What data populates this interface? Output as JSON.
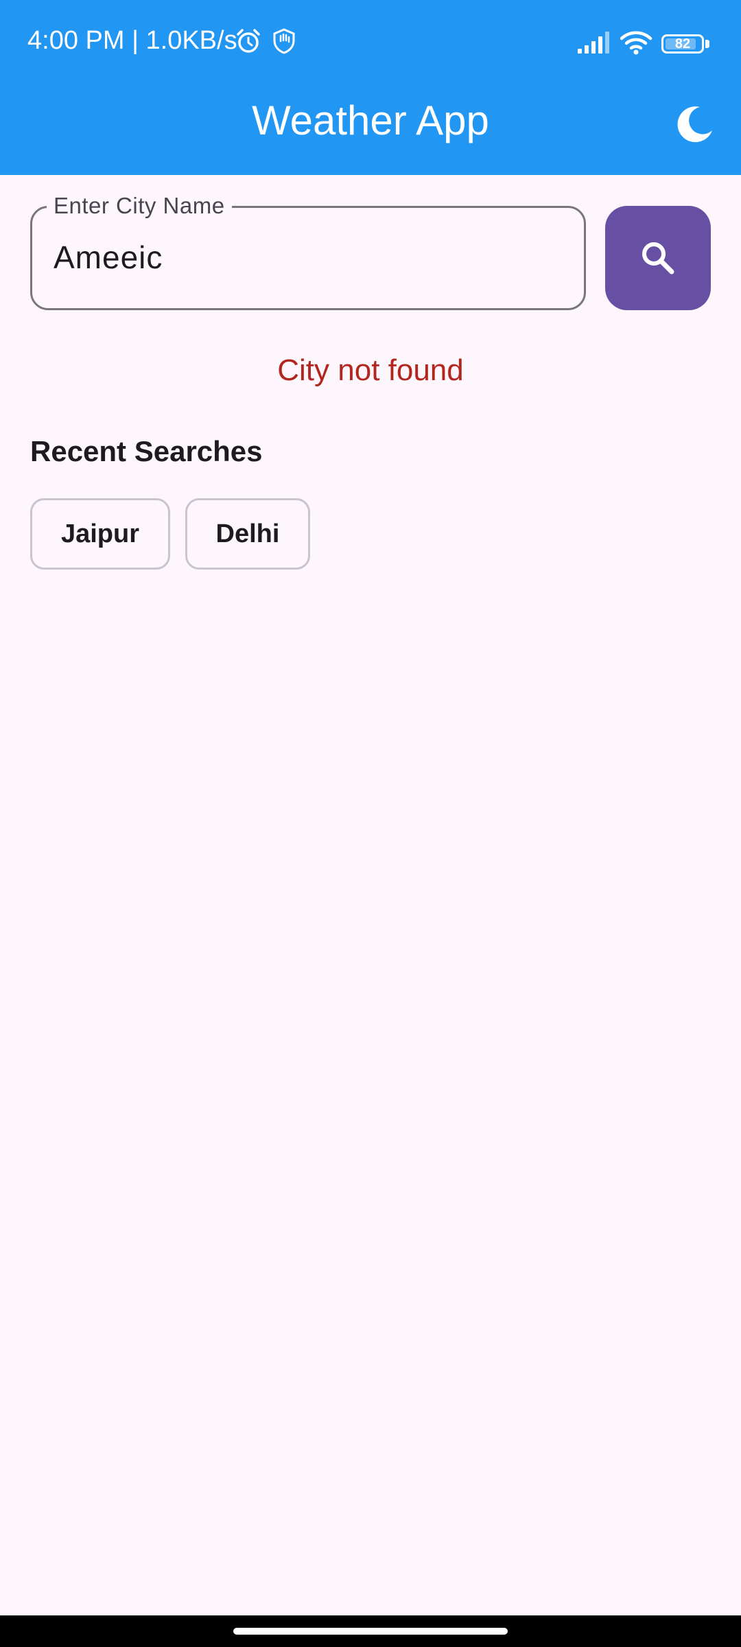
{
  "status_bar": {
    "time_speed": "4:00 PM | 1.0KB/s",
    "battery": "82",
    "icons": [
      "alarm-icon",
      "shield-hand-icon",
      "signal-icon",
      "wifi-icon",
      "battery-icon"
    ]
  },
  "appbar": {
    "title": "Weather App",
    "theme_icon": "moon-icon",
    "color": "#2196f3"
  },
  "search": {
    "label": "Enter City Name",
    "value": "Ameeic",
    "button_icon": "search-icon",
    "button_color": "#6750a4"
  },
  "error_message": "City not found",
  "recent": {
    "title": "Recent Searches",
    "items": [
      "Jaipur",
      "Delhi"
    ]
  }
}
